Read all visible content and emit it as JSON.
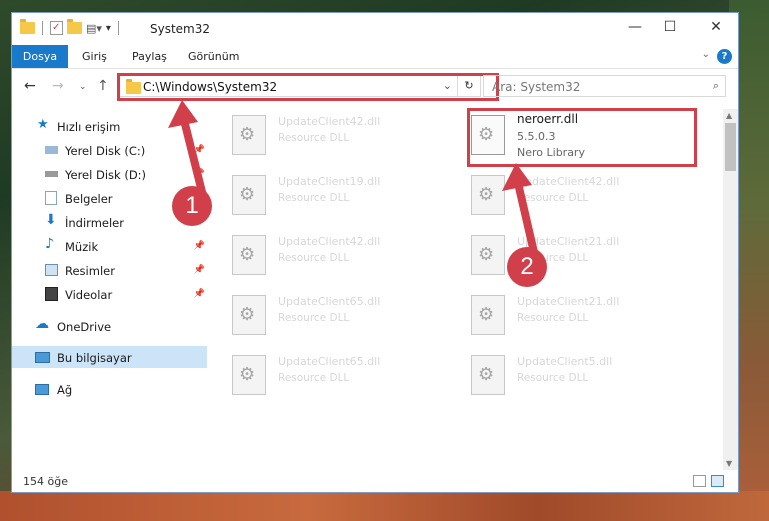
{
  "window": {
    "title": "System32"
  },
  "ribbon": {
    "tabs": [
      "Dosya",
      "Giriş",
      "Paylaş",
      "Görünüm"
    ],
    "help": "?"
  },
  "address": {
    "path": "C:\\Windows\\System32"
  },
  "search": {
    "placeholder": "Ara: System32"
  },
  "sidebar": {
    "items": [
      {
        "label": "Hızlı erişim"
      },
      {
        "label": "Yerel Disk (C:)"
      },
      {
        "label": "Yerel Disk (D:)"
      },
      {
        "label": "Belgeler"
      },
      {
        "label": "İndirmeler"
      },
      {
        "label": "Müzik"
      },
      {
        "label": "Resimler"
      },
      {
        "label": "Videolar"
      },
      {
        "label": "OneDrive"
      },
      {
        "label": "Bu bilgisayar"
      },
      {
        "label": "Ağ"
      }
    ]
  },
  "files": {
    "left": [
      {
        "name": "UpdateClient42.dll",
        "desc": "Resource DLL"
      },
      {
        "name": "UpdateClient19.dll",
        "desc": "Resource DLL"
      },
      {
        "name": "UpdateClient42.dll",
        "desc": "Resource DLL"
      },
      {
        "name": "UpdateClient65.dll",
        "desc": "Resource DLL"
      },
      {
        "name": "UpdateClient65.dll",
        "desc": "Resource DLL"
      }
    ],
    "highlighted": {
      "name": "neroerr.dll",
      "version": "5.5.0.3",
      "desc": "Nero Library"
    },
    "right": [
      {
        "name": "UpdateClient42.dll",
        "desc": "Resource DLL"
      },
      {
        "name": "UpdateClient21.dll",
        "desc": "Resource DLL"
      },
      {
        "name": "UpdateClient21.dll",
        "desc": "Resource DLL"
      },
      {
        "name": "UpdateClient5.dll",
        "desc": "Resource DLL"
      }
    ]
  },
  "status": {
    "count": "154 öğe"
  },
  "annotations": {
    "step1": "1",
    "step2": "2"
  },
  "colors": {
    "accent": "#1979ca",
    "highlight": "#d1404a"
  }
}
